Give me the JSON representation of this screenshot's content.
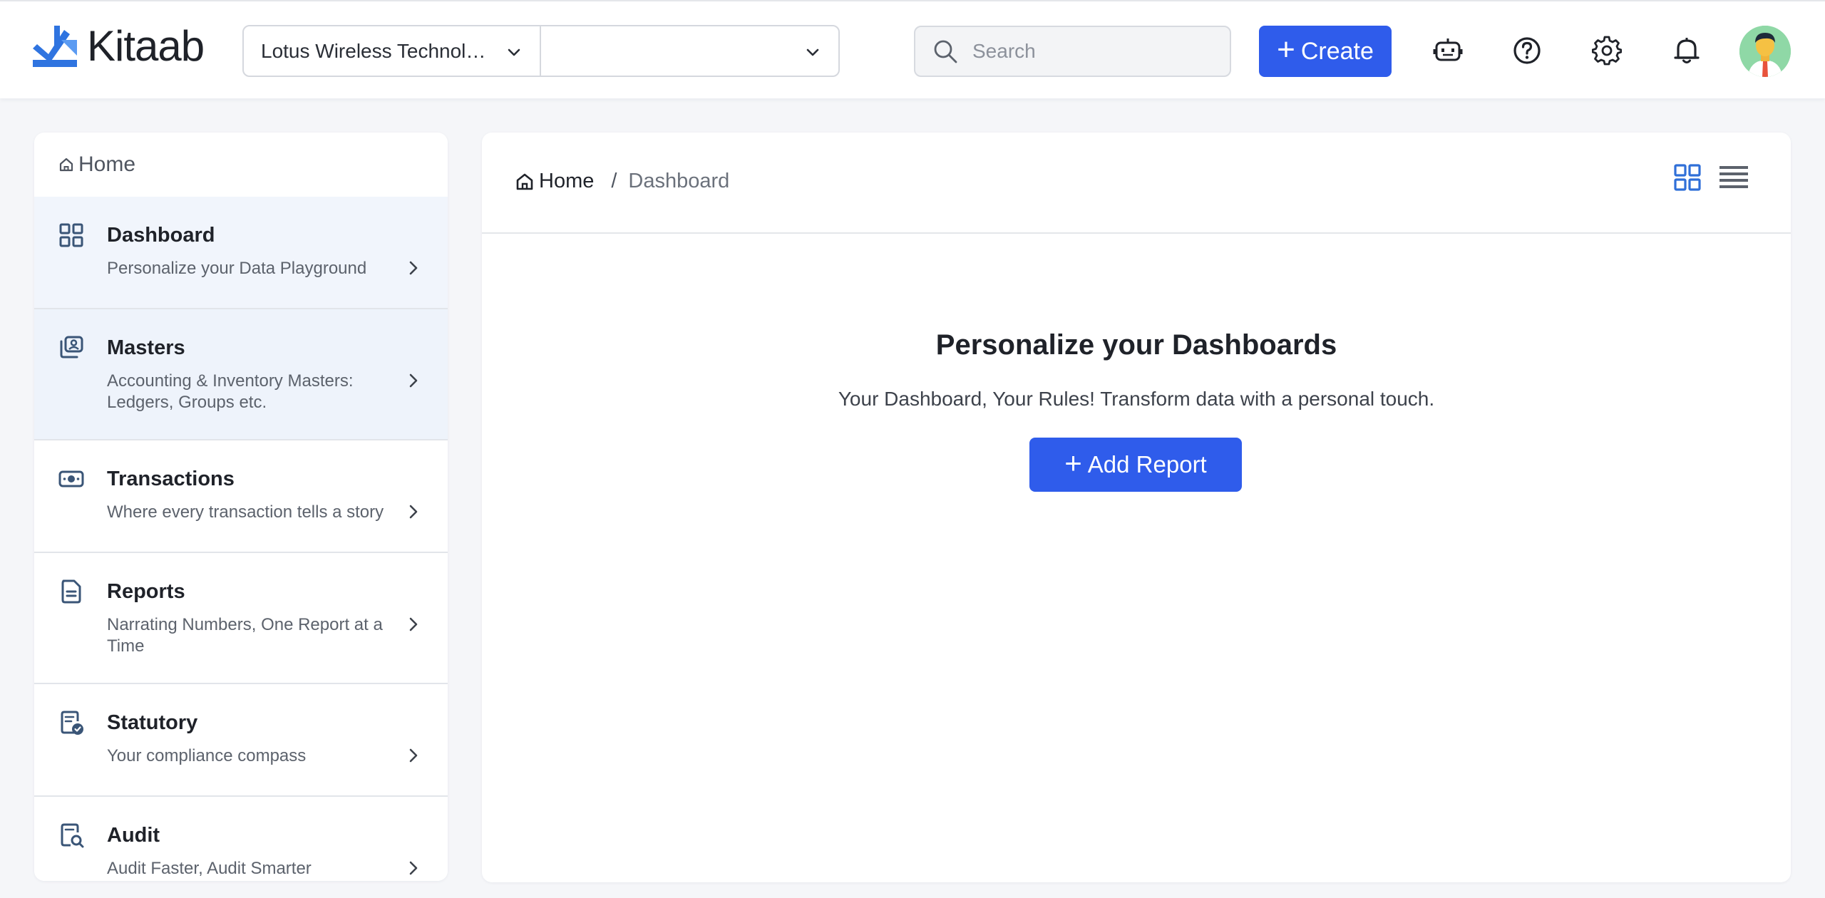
{
  "header": {
    "logo_text": "Kitaab",
    "company_selector": "Lotus Wireless Technol…",
    "secondary_selector": "",
    "search_placeholder": "Search",
    "create_label": "Create",
    "icons": [
      "bot-icon",
      "help-icon",
      "settings-icon",
      "notification-bell-icon",
      "user-avatar"
    ]
  },
  "sidebar": {
    "home_label": "Home",
    "items": [
      {
        "icon": "dashboard-grid-icon",
        "title": "Dashboard",
        "desc": "Personalize your Data Playground"
      },
      {
        "icon": "masters-icon",
        "title": "Masters",
        "desc": "Accounting & Inventory Masters: Ledgers, Groups etc."
      },
      {
        "icon": "transactions-icon",
        "title": "Transactions",
        "desc": "Where every transaction tells a story"
      },
      {
        "icon": "reports-icon",
        "title": "Reports",
        "desc": "Narrating Numbers, One Report at a Time"
      },
      {
        "icon": "statutory-icon",
        "title": "Statutory",
        "desc": "Your compliance compass"
      },
      {
        "icon": "audit-icon",
        "title": "Audit",
        "desc": "Audit Faster, Audit Smarter"
      }
    ]
  },
  "main": {
    "breadcrumb": {
      "home": "Home",
      "separator": "/",
      "current": "Dashboard"
    },
    "empty_state": {
      "title": "Personalize your Dashboards",
      "subtitle": "Your Dashboard, Your Rules! Transform data with a personal touch.",
      "button_label": "Add Report"
    }
  },
  "colors": {
    "accent": "#2f5ceb",
    "nav_icon": "#3a5577",
    "active_view": "#2f6fd8"
  }
}
